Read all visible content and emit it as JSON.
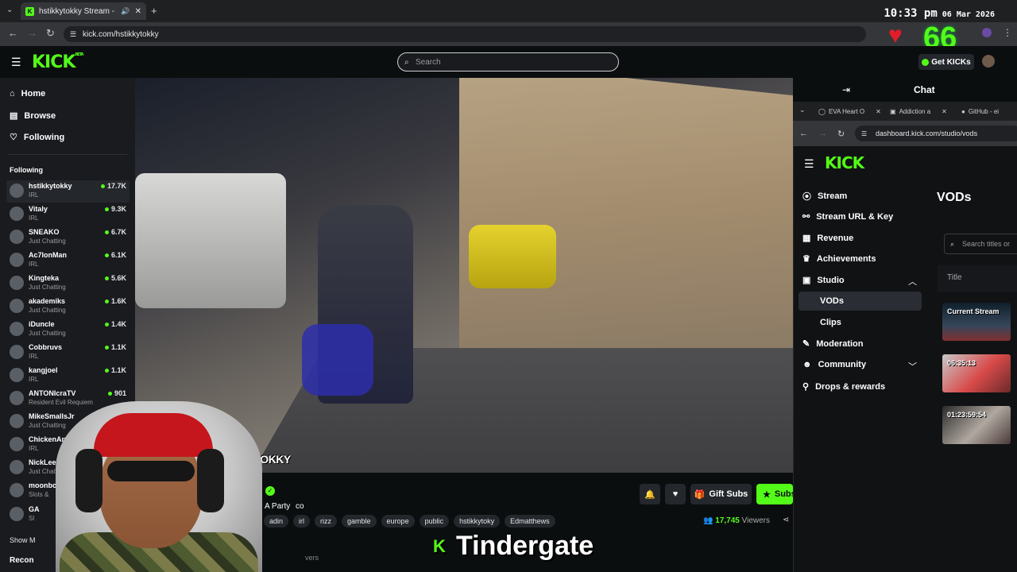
{
  "browser": {
    "tab_title": "hstikkytokky Stream - Watch",
    "url": "kick.com/hstikkytokky"
  },
  "overlay": {
    "time": "10:33 pm",
    "date": "06 Mar 2026",
    "heart_count": "66",
    "caption": "Tindergate"
  },
  "header": {
    "logo": "KICK",
    "logo_badge": "BETA",
    "search_placeholder": "Search",
    "get_kicks": "Get KICKs"
  },
  "sidebar": {
    "nav": [
      {
        "label": "Home",
        "icon": "home-icon"
      },
      {
        "label": "Browse",
        "icon": "browse-icon"
      },
      {
        "label": "Following",
        "icon": "heart-icon"
      }
    ],
    "following_heading": "Following",
    "following": [
      {
        "name": "hstikkytokky",
        "category": "IRL",
        "viewers": "17.7K"
      },
      {
        "name": "Vitaly",
        "category": "IRL",
        "viewers": "9.3K"
      },
      {
        "name": "SNEAKO",
        "category": "Just Chatting",
        "viewers": "6.7K"
      },
      {
        "name": "Ac7IonMan",
        "category": "IRL",
        "viewers": "6.1K"
      },
      {
        "name": "Kingteka",
        "category": "Just Chatting",
        "viewers": "5.6K"
      },
      {
        "name": "akademiks",
        "category": "Just Chatting",
        "viewers": "1.6K"
      },
      {
        "name": "iDuncle",
        "category": "Just Chatting",
        "viewers": "1.4K"
      },
      {
        "name": "Cobbruvs",
        "category": "IRL",
        "viewers": "1.1K"
      },
      {
        "name": "kangjoel",
        "category": "IRL",
        "viewers": "1.1K"
      },
      {
        "name": "ANTONIcraTV",
        "category": "Resident Evil Requiem",
        "viewers": "901"
      },
      {
        "name": "MikeSmallsJr",
        "category": "Just Chatting",
        "viewers": ""
      },
      {
        "name": "ChickenAndy",
        "category": "IRL",
        "viewers": ""
      },
      {
        "name": "NickLee",
        "category": "Just Chatting",
        "viewers": ""
      },
      {
        "name": "moonboo",
        "category": "Slots &",
        "viewers": ""
      },
      {
        "name": "GA",
        "category": "Sl",
        "viewers": ""
      }
    ],
    "show_more": "Show M",
    "recommended": "Recon"
  },
  "stream": {
    "watermark": "TIKKYTOKKY",
    "title_fragment": "A Party",
    "title_suffix": "co",
    "tags": [
      "adin",
      "irl",
      "rizz",
      "gamble",
      "europe",
      "public",
      "hstikkytoky",
      "Edmatthews"
    ],
    "viewers": "17,745",
    "viewers_label": "Viewers",
    "gift_subs": "Gift Subs",
    "subscribe": "Subs",
    "viewers_partial": "vers"
  },
  "chat": {
    "title": "Chat"
  },
  "dashboard": {
    "tabs": [
      "EVA Heart O",
      "Addiction a",
      "GitHub - ei"
    ],
    "url": "dashboard.kick.com/studio/vods",
    "logo": "KICK",
    "nav": [
      {
        "label": "Stream",
        "icon": "broadcast-icon"
      },
      {
        "label": "Stream URL & Key",
        "icon": "link-icon"
      },
      {
        "label": "Revenue",
        "icon": "revenue-icon"
      },
      {
        "label": "Achievements",
        "icon": "trophy-icon"
      },
      {
        "label": "Studio",
        "icon": "studio-icon"
      },
      {
        "label": "Moderation",
        "icon": "wrench-icon"
      },
      {
        "label": "Community",
        "icon": "community-icon"
      },
      {
        "label": "Drops & rewards",
        "icon": "gift-icon"
      }
    ],
    "studio_sub": [
      "VODs",
      "Clips"
    ],
    "page_title": "VODs",
    "search_placeholder": "Search titles or",
    "column_title": "Title",
    "vods": [
      "Current Stream",
      "06:35:13",
      "01:23:59:54"
    ]
  },
  "colors": {
    "accent": "#53fc18",
    "background": "#0b0e0f",
    "sidebar": "#191b1f",
    "heart": "#e21d2a"
  }
}
